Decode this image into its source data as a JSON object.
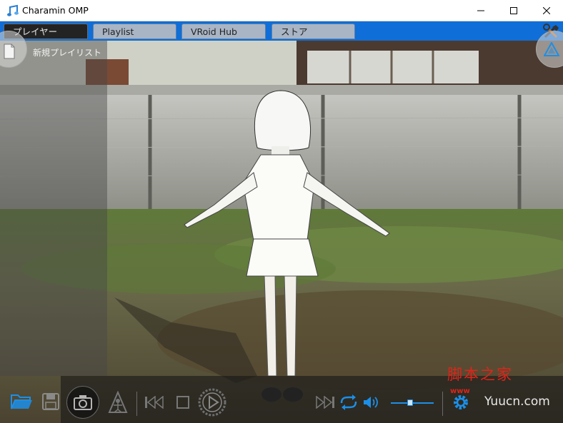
{
  "window": {
    "title": "Charamin OMP"
  },
  "tabs": [
    {
      "label": "プレイヤー",
      "active": true
    },
    {
      "label": "Playlist",
      "active": false
    },
    {
      "label": "VRoid Hub",
      "active": false
    },
    {
      "label": "ストア",
      "active": false
    }
  ],
  "sidebar": {
    "new_playlist_label": "新規プレイリスト"
  },
  "player": {
    "volume_level": 0.45
  },
  "watermark": {
    "title": "脚本之家",
    "www": "www",
    "site": "Yuucn.com"
  },
  "colors": {
    "accent": "#1c8fe8",
    "tabbar": "#0f6ed7",
    "watermark": "#e0241a"
  },
  "icons": [
    "app-note-icon",
    "tools-icon",
    "document-icon",
    "character-icon",
    "folder-open-icon",
    "save-icon",
    "camera-icon",
    "pose-icon",
    "skip-back-icon",
    "stop-icon",
    "play-icon",
    "skip-forward-icon",
    "repeat-icon",
    "volume-icon",
    "gear-icon"
  ]
}
